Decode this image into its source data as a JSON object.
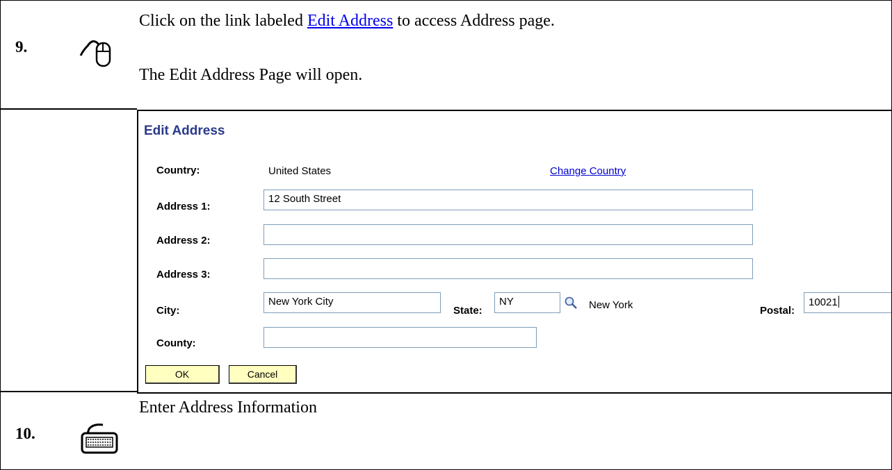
{
  "step9": {
    "number": "9.",
    "instruction_prefix": "Click on the link labeled ",
    "instruction_link": "Edit Address",
    "instruction_suffix": " to access Address page.",
    "result": "The Edit Address Page will open.",
    "icon": "mouse-icon"
  },
  "edit_address": {
    "title": "Edit Address",
    "country_label": "Country:",
    "country_value": "United States",
    "change_country_link": "Change Country",
    "address1_label": "Address 1:",
    "address1_value": "12 South Street",
    "address2_label": "Address 2:",
    "address2_value": "",
    "address3_label": "Address 3:",
    "address3_value": "",
    "city_label": "City:",
    "city_value": "New York City",
    "state_label": "State:",
    "state_value": "NY",
    "state_lookup_icon": "magnifier-icon",
    "state_description": "New York",
    "postal_label": "Postal:",
    "postal_value": "10021",
    "county_label": "County:",
    "county_value": "",
    "ok_label": "OK",
    "cancel_label": "Cancel",
    "button_color": "#ffffc0",
    "title_color": "#2a3a8a"
  },
  "step10": {
    "number": "10.",
    "instruction": "Enter Address Information",
    "icon": "keyboard-icon"
  }
}
